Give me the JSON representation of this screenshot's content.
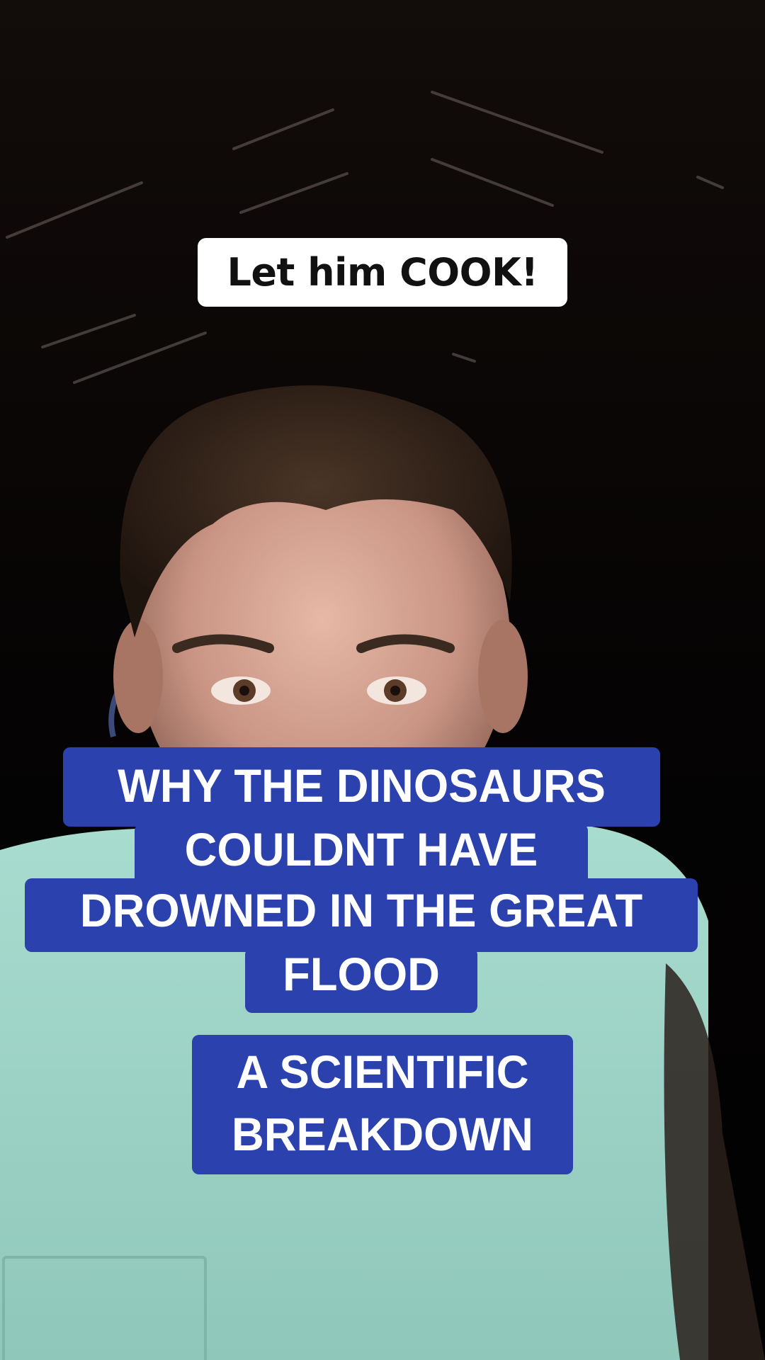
{
  "overlay": {
    "top_caption": "Let him COOK!",
    "title_lines": [
      "WHY THE DINOSAURS",
      "COULDNT HAVE",
      "DROWNED IN THE GREAT",
      "FLOOD"
    ],
    "subtitle_lines": [
      "A SCIENTIFIC",
      "BREAKDOWN"
    ]
  },
  "colors": {
    "caption_bg": "#ffffff",
    "caption_text": "#111111",
    "title_bg": "#2b41ad",
    "title_text": "#ffffff",
    "shirt": "#9fd3c7",
    "background": "#050404"
  }
}
